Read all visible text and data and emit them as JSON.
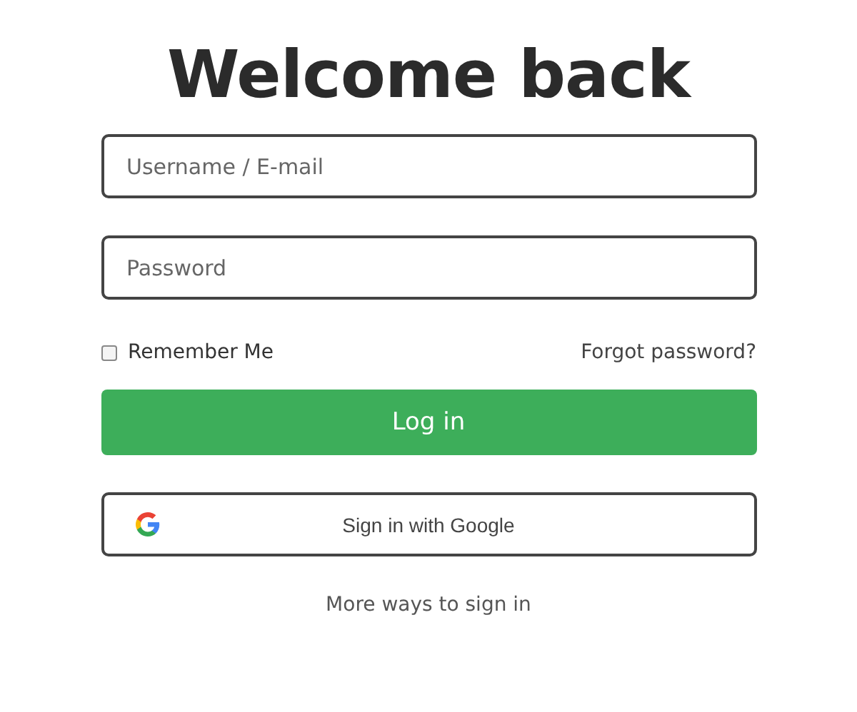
{
  "title": "Welcome back",
  "username_field": {
    "placeholder": "Username / E-mail"
  },
  "password_field": {
    "placeholder": "Password"
  },
  "remember": {
    "label": "Remember Me",
    "checked": false
  },
  "forgot_link": "Forgot password?",
  "login_button": "Log in",
  "google_button": "Sign in with Google",
  "more_link": "More ways to sign in"
}
